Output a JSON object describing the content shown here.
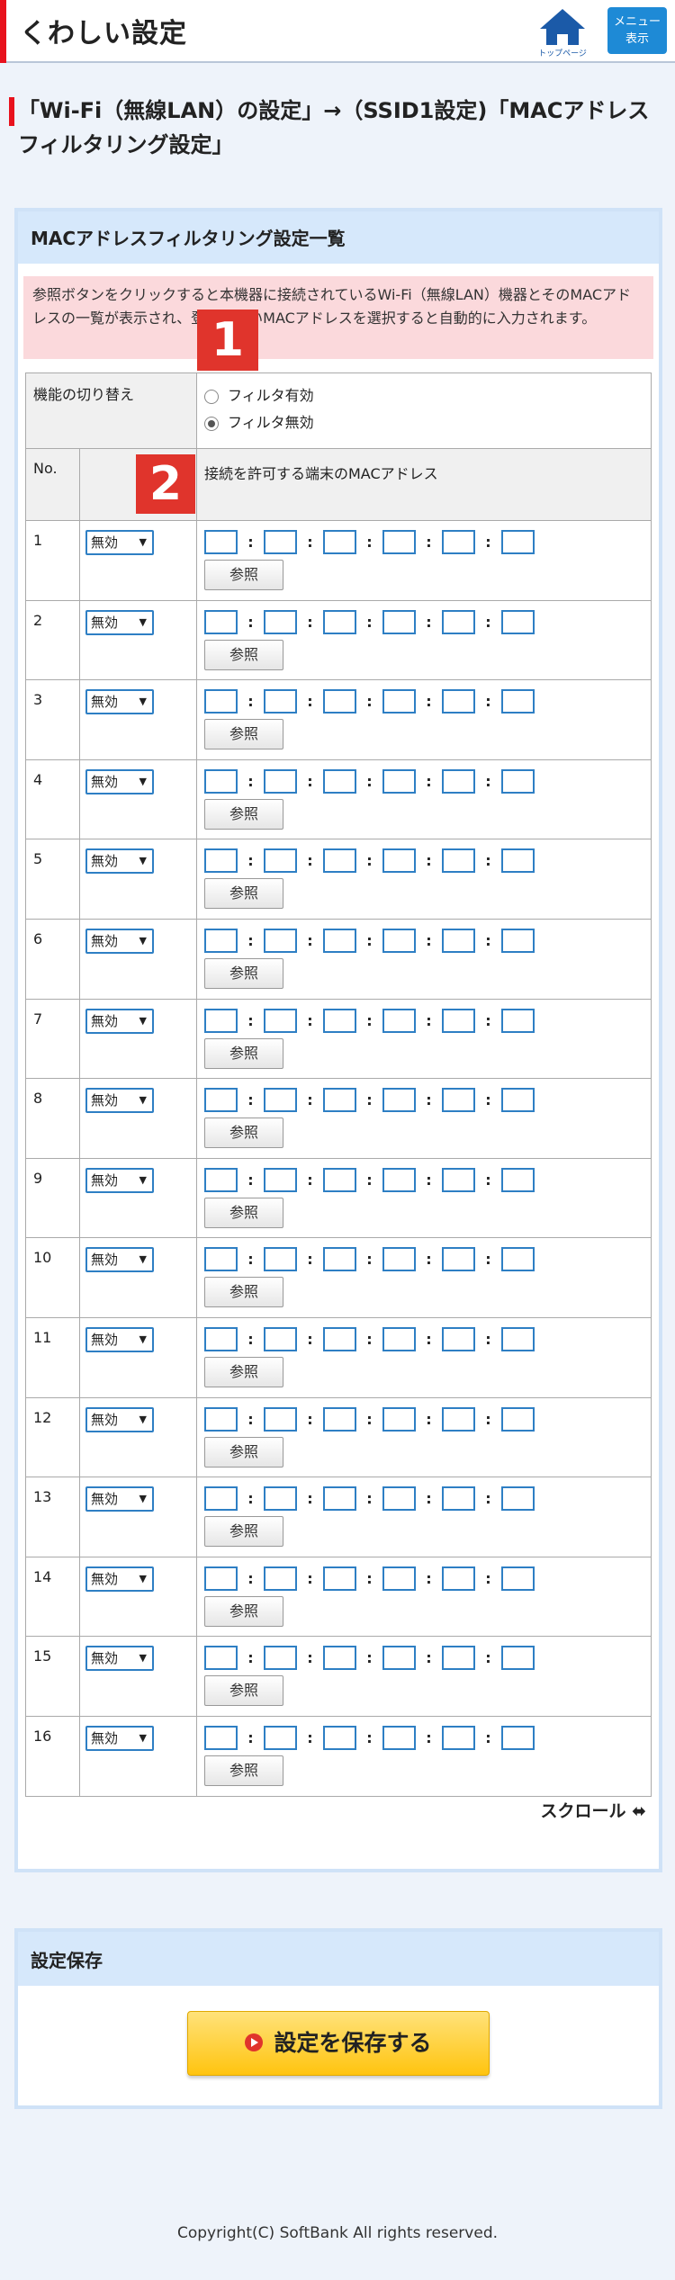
{
  "header": {
    "title": "くわしい設定",
    "home_label": "トップページ",
    "menu_label_1": "メニュー",
    "menu_label_2": "表示"
  },
  "breadcrumb": "「Wi-Fi（無線LAN）の設定」→（SSID1設定)「MACアドレスフィルタリング設定」",
  "panel": {
    "title": "MACアドレスフィルタリング設定一覧",
    "note": "参照ボタンをクリックすると本機器に接続されているWi-Fi（無線LAN）機器とそのMACアドレスの一覧が表示され、登録したいMACアドレスを選択すると自動的に入力されます。",
    "badge1": "1",
    "badge2": "2",
    "switch_label": "機能の切り替え",
    "radio_on_label": "フィルタ有効",
    "radio_off_label": "フィルタ無効",
    "selected_mode": "フィルタ無効",
    "col_no": "No.",
    "col_mac": "接続を許可する端末のMACアドレス",
    "select_value": "無効",
    "ref_label": "参照",
    "rows": [
      1,
      2,
      3,
      4,
      5,
      6,
      7,
      8,
      9,
      10,
      11,
      12,
      13,
      14,
      15,
      16
    ],
    "scroll_label": "スクロール ⬌"
  },
  "save": {
    "title": "設定保存",
    "button": "設定を保存する"
  },
  "footer": {
    "copyright": "Copyright(C) SoftBank All rights reserved."
  },
  "colors": {
    "accent": "#e8121d",
    "primary": "#1e8ad6",
    "save_button": "#ffc40f"
  }
}
